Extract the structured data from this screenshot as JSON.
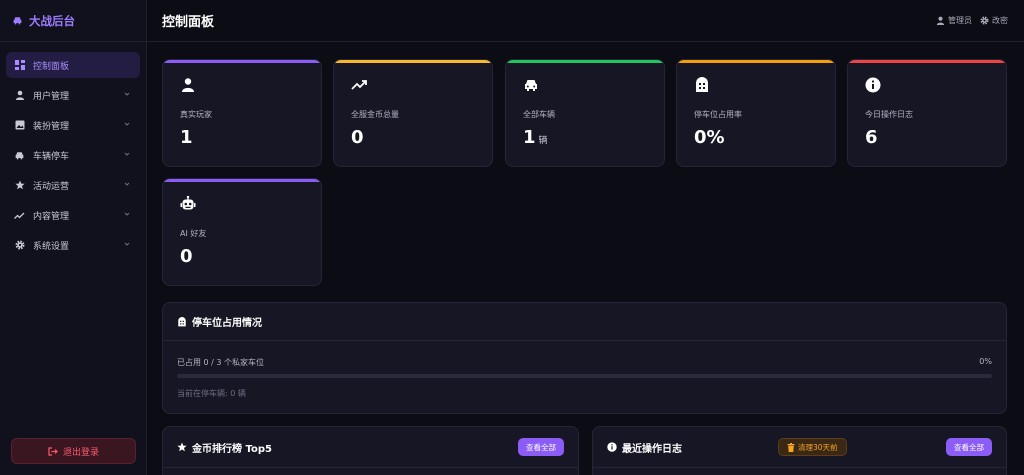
{
  "sidebar": {
    "brand": "大战后台",
    "items": [
      {
        "label": "控制面板"
      },
      {
        "label": "用户管理"
      },
      {
        "label": "装扮管理"
      },
      {
        "label": "车辆停车"
      },
      {
        "label": "活动运营"
      },
      {
        "label": "内容管理"
      },
      {
        "label": "系统设置"
      }
    ],
    "logout": "退出登录"
  },
  "header": {
    "title": "控制面板",
    "admin": "管理员",
    "password": "改密"
  },
  "stats": [
    {
      "label": "真实玩家",
      "value": "1",
      "unit": "",
      "color": "#8b5cf6",
      "icon": "user-icon"
    },
    {
      "label": "全服金币总量",
      "value": "0",
      "unit": "",
      "color": "#f5b82e",
      "icon": "trend-icon"
    },
    {
      "label": "全部车辆",
      "value": "1",
      "unit": "辆",
      "color": "#22c55e",
      "icon": "car-icon"
    },
    {
      "label": "停车位占用率",
      "value": "0%",
      "unit": "",
      "color": "#f59e0b",
      "icon": "parking-icon"
    },
    {
      "label": "今日操作日志",
      "value": "6",
      "unit": "",
      "color": "#ef4444",
      "icon": "info-icon"
    },
    {
      "label": "AI 好友",
      "value": "0",
      "unit": "",
      "color": "#8b5cf6",
      "icon": "robot-icon"
    }
  ],
  "parking": {
    "title": "停车位占用情况",
    "occupied_text": "已占用 0 / 3 个私家车位",
    "percent_text": "0%",
    "percent": 0,
    "current": "当前在停车辆: 0 辆"
  },
  "leaderboard": {
    "title": "金币排行榜 Top5",
    "view_all": "查看全部"
  },
  "logs": {
    "title": "最近操作日志",
    "clean": "清理30天前",
    "view_all": "查看全部"
  }
}
